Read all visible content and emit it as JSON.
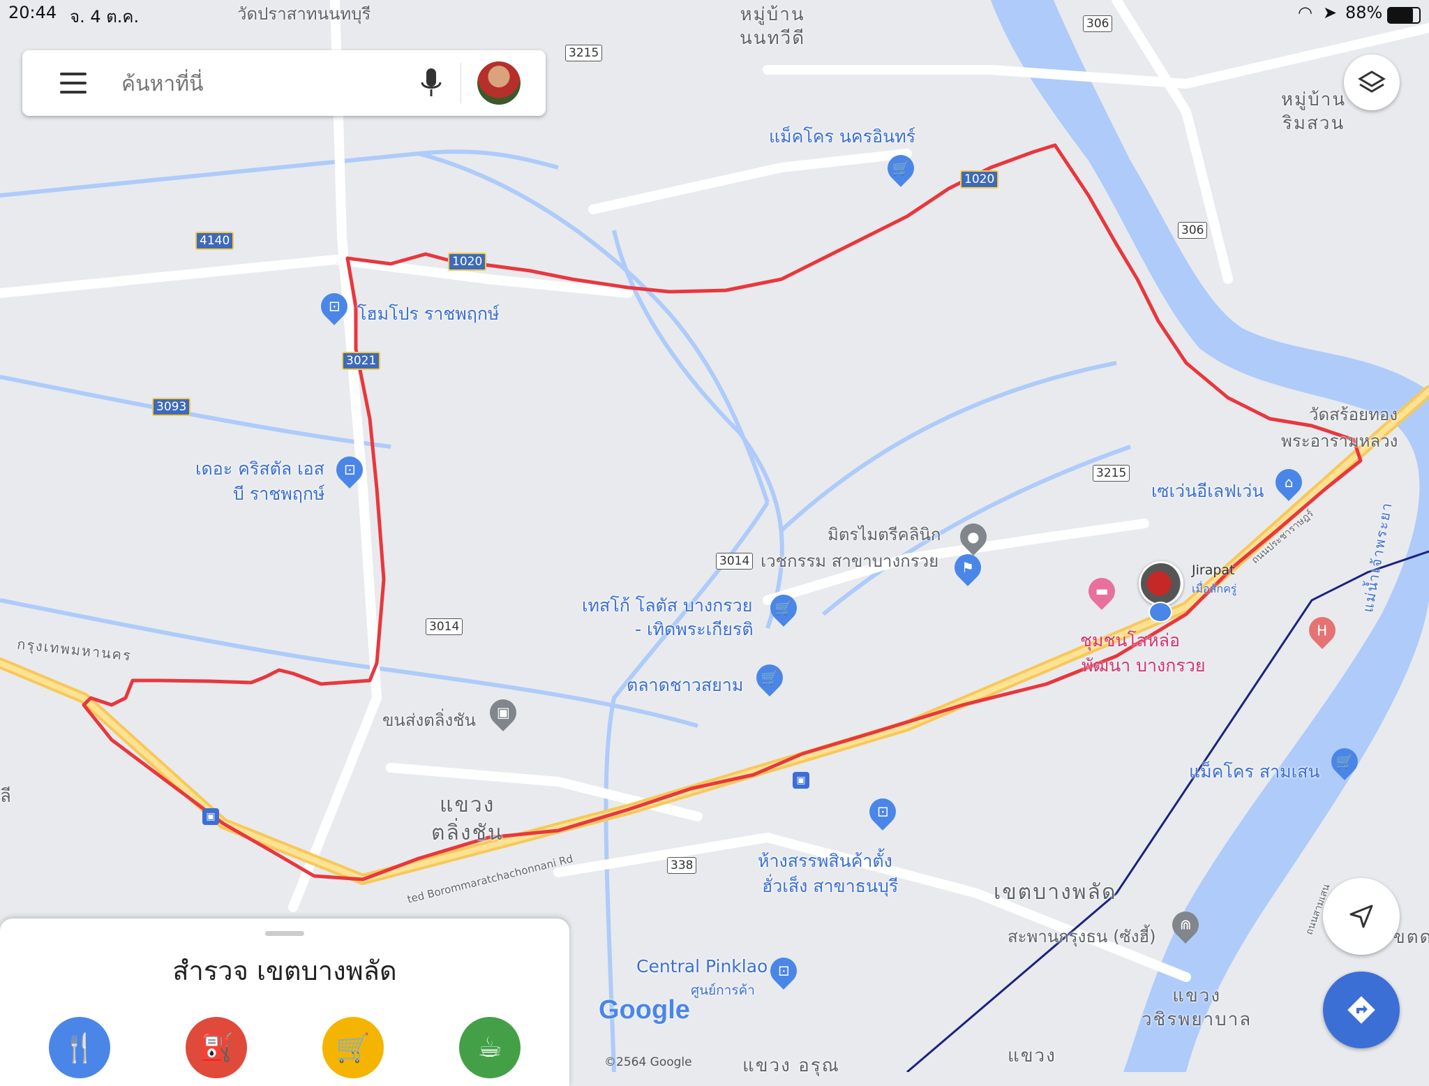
{
  "status": {
    "time": "20:44",
    "date": "จ. 4 ต.ค.",
    "battery": "88%"
  },
  "search": {
    "placeholder": "ค้นหาที่นี่"
  },
  "route_color": "#e8373e",
  "shields": [
    "3215",
    "306",
    "1020",
    "4140",
    "1020",
    "3021",
    "3093",
    "306",
    "3215",
    "3014",
    "3014",
    "338"
  ],
  "pois": {
    "makro_nakhonin": "แม็คโคร นครอินทร์",
    "homepro": "โฮมโปร ราชพฤกษ์",
    "crystal_1": "เดอะ คริสตัล เอส",
    "crystal_2": "บี ราชพฤกษ์",
    "clinic_1": "มิตรไมตรีคลินิก",
    "clinic_2": "เวชกรรม สาขาบางกรวย",
    "tesco_1": "เทสโก้ โลตัส บางกรวย",
    "tesco_2": "- เทิดพระเกียรติ",
    "talad": "ตลาดชาวสยาม",
    "bus_terminal": "ขนส่งตลิ่งชัน",
    "seven": "เซเว่นอีเลฟเว่น",
    "wat_soi_1": "วัดสร้อยทอง",
    "wat_soi_2": "พระอารามหลวง",
    "community_1": "ชุมชนโสหล่อ",
    "community_2": "พัฒนา บางกรวย",
    "makro_samsen": "แม็คโคร สามเสน",
    "hangseng_1": "ห้างสรรพสินค้าตั้ง",
    "hangseng_2": "ฮั่วเส็ง สาขาธนบุรี",
    "central": "Central Pinklao",
    "central_sub": "ศูนย์การค้า",
    "bridge": "สะพานกรุงธน (ซังฮี้)",
    "wat_top": "วัดปราสาทนนทบุรี"
  },
  "areas": {
    "village_1": "หมู่บ้าน",
    "village_1b": "นนทวีดี",
    "village_2": "หมู่บ้าน",
    "village_2b": "ริมสวน",
    "talingchan_1": "แขวง",
    "talingchan_2": "ตลิ่งชัน",
    "bangphlat": "เขตบางพลัด",
    "wachira_1": "แขวง",
    "wachira_2": "วชิรพยาบาล",
    "bkk": "กรุงเทพมหานคร",
    "khwaeng_bottom": "แขวง",
    "khwaeng_bottom2": "แขวง อรุณ",
    "road_name": "ted Borommaratchachonnani Rd",
    "river": "แม่น้ำเจ้าพระยา",
    "edge_left": "ลี",
    "edge_right": "ขตด",
    "road_small": "ถนนสามเสน",
    "road_small2": "ถนนประชาราษฎร์"
  },
  "user": {
    "name": "Jirapat",
    "sub": "เมื่อสักครู่"
  },
  "sheet": {
    "title": "สำรวจ เขตบางพลัด"
  },
  "google_logo": "Google",
  "copyright": "©2564 Google"
}
